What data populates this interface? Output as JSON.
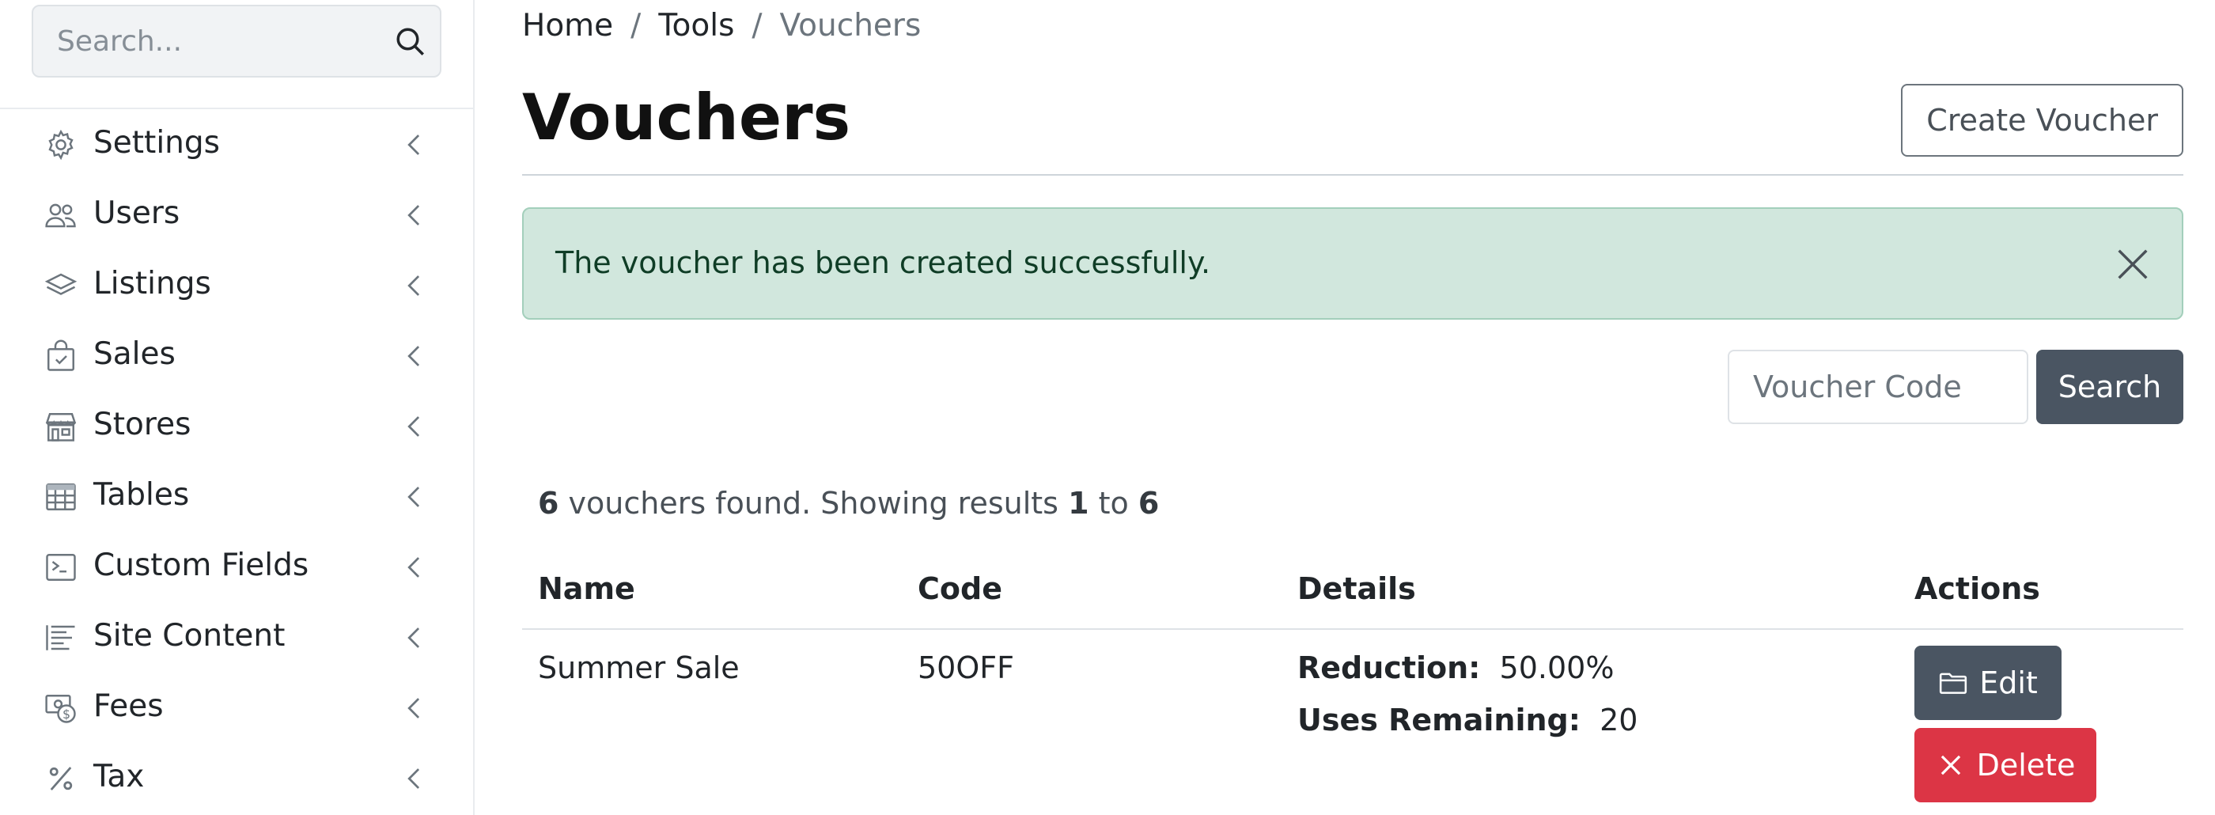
{
  "sidebar": {
    "search_placeholder": "Search...",
    "items": [
      {
        "label": "Settings",
        "icon": "gear-icon"
      },
      {
        "label": "Users",
        "icon": "users-icon"
      },
      {
        "label": "Listings",
        "icon": "layers-icon"
      },
      {
        "label": "Sales",
        "icon": "bag-check-icon"
      },
      {
        "label": "Stores",
        "icon": "shop-icon"
      },
      {
        "label": "Tables",
        "icon": "table-icon"
      },
      {
        "label": "Custom Fields",
        "icon": "terminal-icon"
      },
      {
        "label": "Site Content",
        "icon": "text-lines-icon"
      },
      {
        "label": "Fees",
        "icon": "cash-icon"
      },
      {
        "label": "Tax",
        "icon": "percent-icon"
      }
    ]
  },
  "breadcrumb": {
    "home": "Home",
    "sep": "/",
    "tools": "Tools",
    "current": "Vouchers"
  },
  "page": {
    "title": "Vouchers",
    "create_label": "Create Voucher"
  },
  "alert": {
    "message": "The voucher has been created successfully.",
    "color": "#d1e7dd"
  },
  "voucher_search": {
    "placeholder": "Voucher Code",
    "button_label": "Search"
  },
  "summary": {
    "count": "6",
    "text1": "vouchers found. Showing results",
    "from": "1",
    "to_word": "to",
    "to": "6"
  },
  "table": {
    "headers": {
      "name": "Name",
      "code": "Code",
      "details": "Details",
      "actions": "Actions"
    },
    "rows": [
      {
        "name": "Summer Sale",
        "code": "50OFF",
        "reduction_label": "Reduction:",
        "reduction_value": "50.00%",
        "uses_label": "Uses Remaining:",
        "uses_value": "20",
        "edit_label": "Edit",
        "delete_label": "Delete"
      }
    ]
  },
  "colors": {
    "primary_dark": "#4a5562",
    "danger": "#dc3545",
    "success_bg": "#d1e7dd"
  }
}
